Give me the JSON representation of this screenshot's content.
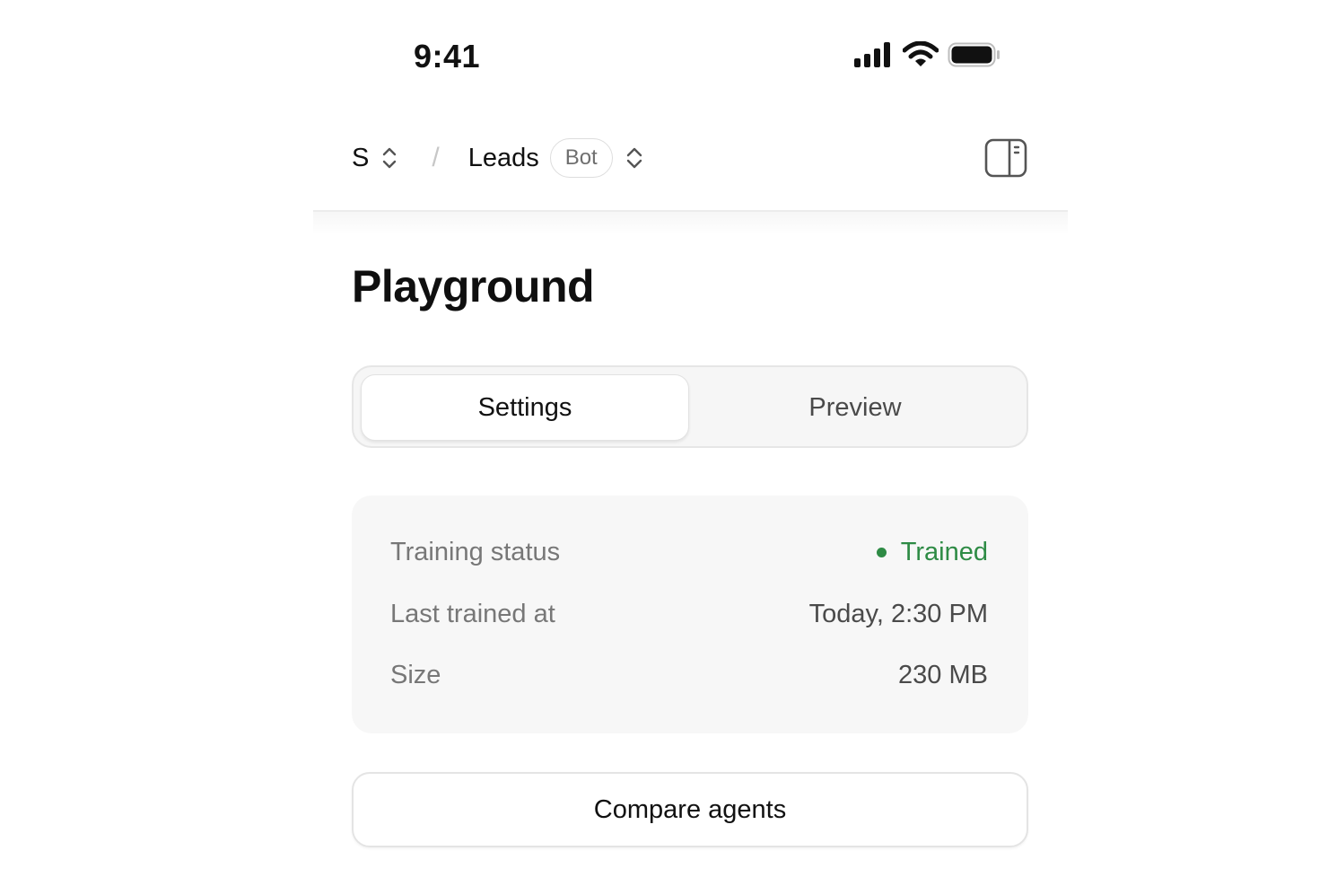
{
  "status_bar": {
    "time": "9:41",
    "icons": [
      "cellular-signal-icon",
      "wifi-icon",
      "battery-icon"
    ]
  },
  "header": {
    "workspace": "S",
    "separator": "/",
    "project": "Leads",
    "badge": "Bot",
    "icons": [
      "chevron-updown-icon",
      "panel-toggle-icon"
    ]
  },
  "page": {
    "title": "Playground"
  },
  "tabs": [
    {
      "label": "Settings",
      "active": true
    },
    {
      "label": "Preview",
      "active": false
    }
  ],
  "info": {
    "rows": [
      {
        "label": "Training status",
        "value": "Trained"
      },
      {
        "label": "Last trained at",
        "value": "Today, 2:30 PM"
      },
      {
        "label": "Size",
        "value": "230 MB"
      }
    ]
  },
  "actions": {
    "compare_label": "Compare agents"
  },
  "colors": {
    "status_trained": "#2e8b45",
    "card_background": "#f7f7f7",
    "segmented_background": "#f6f6f6",
    "text_primary": "#111111",
    "text_muted": "#777777"
  }
}
